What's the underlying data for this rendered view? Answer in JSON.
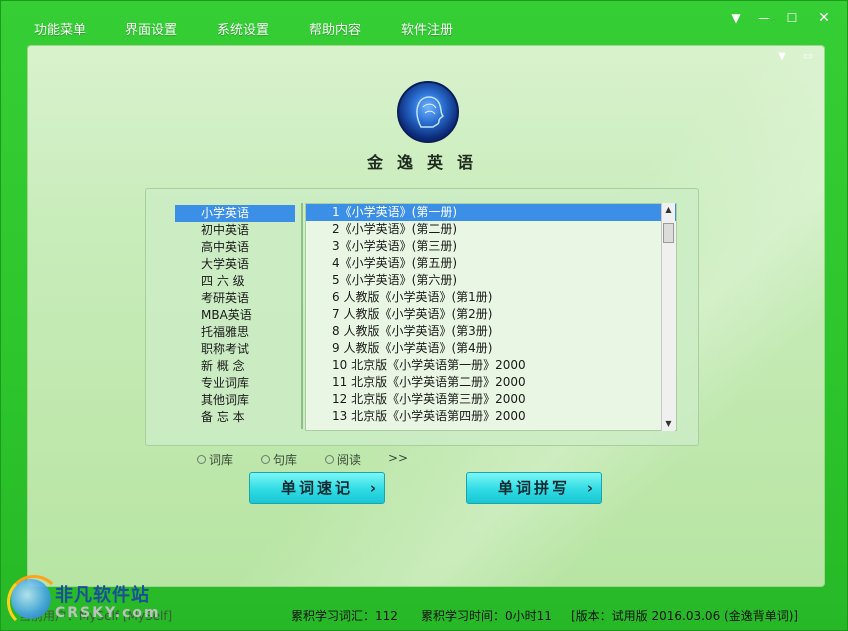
{
  "menu": {
    "items": [
      "功能菜单",
      "界面设置",
      "系统设置",
      "帮助内容",
      "软件注册"
    ]
  },
  "window_controls": {
    "menu_icon": "▼",
    "minimize_icon": "—",
    "maximize_icon": "☐",
    "close_icon": "✕"
  },
  "panel_controls": {
    "collapse_icon": "▼",
    "restore_icon": "▭"
  },
  "app": {
    "title": "金逸英语",
    "logo_icon": "head-logo-icon"
  },
  "categories": [
    "小学英语",
    "初中英语",
    "高中英语",
    "大学英语",
    "四 六 级",
    "考研英语",
    "MBA英语",
    "托福雅思",
    "职称考试",
    "新 概 念",
    "专业词库",
    "其他词库",
    "备 忘 本"
  ],
  "selected_category": 0,
  "books": [
    "1《小学英语》(第一册)",
    "2《小学英语》(第二册)",
    "3《小学英语》(第三册)",
    "4《小学英语》(第五册)",
    "5《小学英语》(第六册)",
    "6 人教版《小学英语》(第1册)",
    "7 人教版《小学英语》(第2册)",
    "8 人教版《小学英语》(第3册)",
    "9 人教版《小学英语》(第4册)",
    "10 北京版《小学英语第一册》2000",
    "11 北京版《小学英语第二册》2000",
    "12 北京版《小学英语第三册》2000",
    "13 北京版《小学英语第四册》2000"
  ],
  "selected_book": 0,
  "modes": {
    "ciku": "词库",
    "juku": "句库",
    "yuedu": "阅读",
    "more": ">>"
  },
  "buttons": {
    "word_memory": "单词速记",
    "word_spell": "单词拼写",
    "chevron": "›"
  },
  "status": {
    "user": "当前用户：MySelf  [MySelf]",
    "words": "累积学习词汇：112",
    "time": "累积学习时间：0小时11",
    "version": "[版本：试用版   2016.03.06  (金逸背单词)]"
  },
  "watermark": {
    "line1": "非凡软件站",
    "line2": "CRSKY.com"
  },
  "colors": {
    "frame_green": "#2dc92d",
    "selection_blue": "#3b8fe6",
    "button_cyan": "#2fdbe4"
  }
}
